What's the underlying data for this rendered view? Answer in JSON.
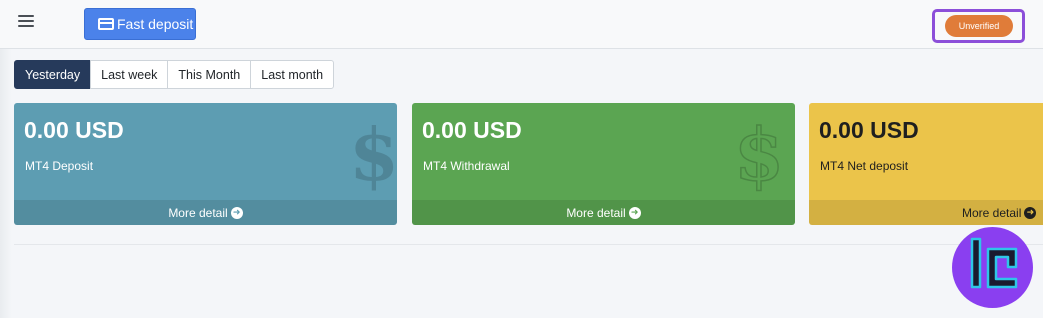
{
  "navbar": {
    "fast_deposit_label": "Fast deposit",
    "status_badge": "Unverified"
  },
  "periods": [
    "Yesterday",
    "Last week",
    "This Month",
    "Last month"
  ],
  "cards": [
    {
      "amount": "0.00 USD",
      "label": "MT4 Deposit",
      "more": "More detail"
    },
    {
      "amount": "0.00 USD",
      "label": "MT4 Withdrawal",
      "more": "More detail"
    },
    {
      "amount": "0.00 USD",
      "label": "MT4 Net deposit",
      "more": "More detail"
    }
  ],
  "icons": {
    "menu": "hamburger-menu-icon",
    "deposit": "credit-card-icon",
    "dollar": "dollar-sign-icon",
    "arrow": "arrow-circle-right-icon",
    "logo": "tc-logo"
  },
  "colors": {
    "primary": "#4b82ea",
    "active_period": "#263a5b",
    "badge": "#e07c39",
    "badge_highlight": "#8c4fd9",
    "card_info": "#5d9db2",
    "card_success": "#5ba552",
    "card_warning": "#ebc44a",
    "logo_bg": "#8a3ff0"
  }
}
